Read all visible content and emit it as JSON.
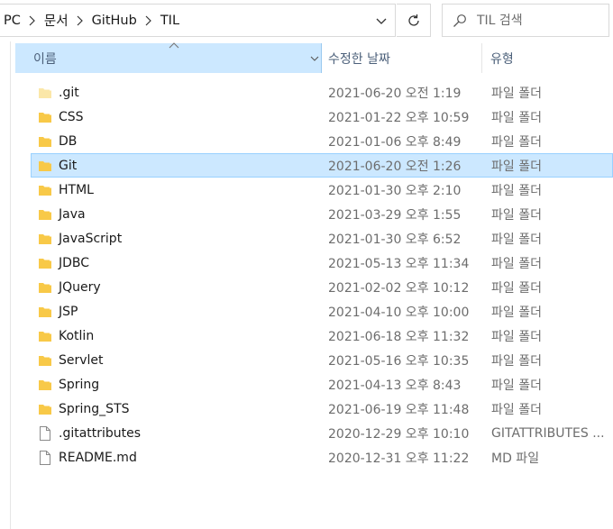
{
  "address": {
    "breadcrumbs": [
      "PC",
      "문서",
      "GitHub",
      "TIL"
    ]
  },
  "search": {
    "placeholder": "TIL 검색"
  },
  "columns": {
    "name": "이름",
    "date": "수정한 날짜",
    "type": "유형"
  },
  "files": [
    {
      "name": ".git",
      "date": "2021-06-20 오전 1:19",
      "type": "파일 폴더",
      "kind": "folder-hidden"
    },
    {
      "name": "CSS",
      "date": "2021-01-22 오후 10:59",
      "type": "파일 폴더",
      "kind": "folder"
    },
    {
      "name": "DB",
      "date": "2021-01-06 오후 8:49",
      "type": "파일 폴더",
      "kind": "folder"
    },
    {
      "name": "Git",
      "date": "2021-06-20 오전 1:26",
      "type": "파일 폴더",
      "kind": "folder",
      "selected": true
    },
    {
      "name": "HTML",
      "date": "2021-01-30 오후 2:10",
      "type": "파일 폴더",
      "kind": "folder"
    },
    {
      "name": "Java",
      "date": "2021-03-29 오후 1:55",
      "type": "파일 폴더",
      "kind": "folder"
    },
    {
      "name": "JavaScript",
      "date": "2021-01-30 오후 6:52",
      "type": "파일 폴더",
      "kind": "folder"
    },
    {
      "name": "JDBC",
      "date": "2021-05-13 오후 11:34",
      "type": "파일 폴더",
      "kind": "folder"
    },
    {
      "name": "JQuery",
      "date": "2021-02-02 오후 10:12",
      "type": "파일 폴더",
      "kind": "folder"
    },
    {
      "name": "JSP",
      "date": "2021-04-10 오후 10:00",
      "type": "파일 폴더",
      "kind": "folder"
    },
    {
      "name": "Kotlin",
      "date": "2021-06-18 오후 11:32",
      "type": "파일 폴더",
      "kind": "folder"
    },
    {
      "name": "Servlet",
      "date": "2021-05-16 오후 10:35",
      "type": "파일 폴더",
      "kind": "folder"
    },
    {
      "name": "Spring",
      "date": "2021-04-13 오후 8:43",
      "type": "파일 폴더",
      "kind": "folder"
    },
    {
      "name": "Spring_STS",
      "date": "2021-06-19 오후 11:48",
      "type": "파일 폴더",
      "kind": "folder"
    },
    {
      "name": ".gitattributes",
      "date": "2020-12-29 오후 10:10",
      "type": "GITATTRIBUTES ...",
      "kind": "file"
    },
    {
      "name": "README.md",
      "date": "2020-12-31 오후 11:22",
      "type": "MD 파일",
      "kind": "file"
    }
  ],
  "colors": {
    "folder": "#f8c948",
    "folder_hidden": "#fbe7a8",
    "selection": "#cce8ff",
    "selection_border": "#99d1ff"
  }
}
